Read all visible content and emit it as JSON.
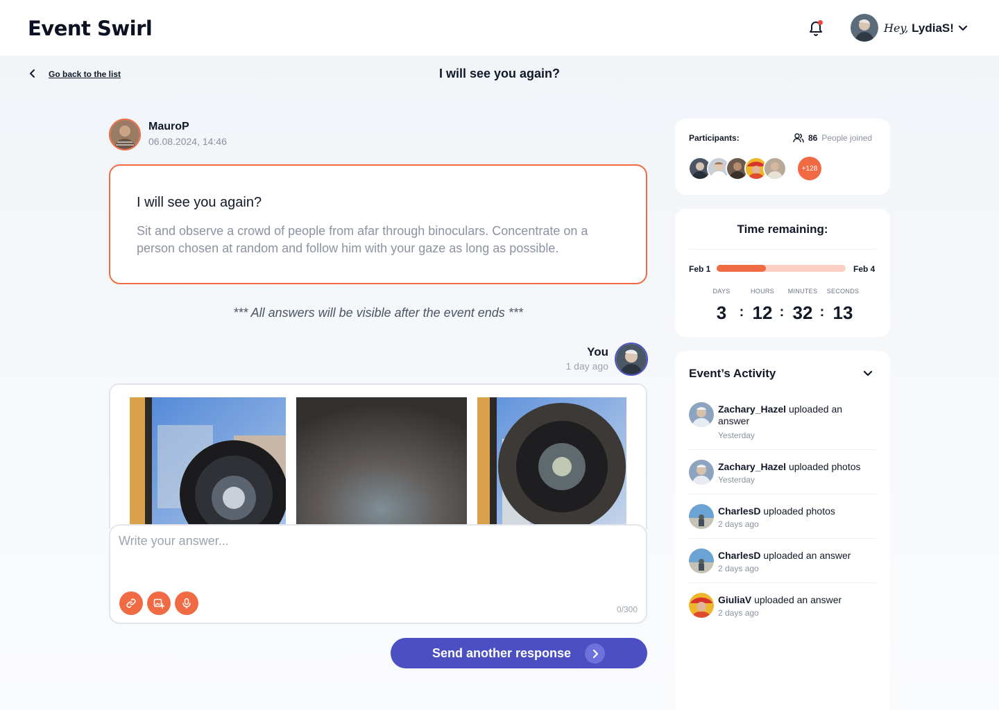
{
  "header": {
    "logo": "Event Swirl",
    "greeting_prefix": "Hey,",
    "username": "LydiaS!"
  },
  "nav": {
    "back_label": "Go back to the list",
    "page_title": "I will see you again?"
  },
  "post": {
    "author": "MauroP",
    "date": "06.08.2024, 14:46",
    "title": "I will see you again?",
    "body": "Sit and observe a crowd of people from afar through binoculars. Concentrate on a person chosen at random and follow him with your gaze as long as possible."
  },
  "notice": "*** All answers will be visible after the event ends ***",
  "response": {
    "author": "You",
    "time": "1 day ago"
  },
  "composer": {
    "placeholder": "Write your answer...",
    "counter": "0/300",
    "send_label": "Send another response"
  },
  "participants": {
    "label": "Participants:",
    "count": "86",
    "joined_label": "People joined",
    "more": "+128"
  },
  "timer": {
    "title": "Time remaining:",
    "start": "Feb 1",
    "end": "Feb 4",
    "progress": 0.38,
    "units": [
      {
        "label": "DAYS",
        "value": "3"
      },
      {
        "label": "HOURS",
        "value": "12"
      },
      {
        "label": "MINUTES",
        "value": "32"
      },
      {
        "label": "SECONDS",
        "value": "13"
      }
    ],
    "separator": ":"
  },
  "activity": {
    "title": "Event’s Activity",
    "items": [
      {
        "user": "Zachary_Hazel",
        "action": "uploaded an answer",
        "time": "Yesterday"
      },
      {
        "user": "Zachary_Hazel",
        "action": "uploaded photos",
        "time": "Yesterday"
      },
      {
        "user": "CharlesD",
        "action": "uploaded photos",
        "time": "2 days ago"
      },
      {
        "user": "CharlesD",
        "action": "uploaded an answer",
        "time": "2 days ago"
      },
      {
        "user": "GiuliaV",
        "action": "uploaded an answer",
        "time": "2 days ago"
      }
    ]
  },
  "colors": {
    "accent": "#f06a43",
    "primary": "#4b4fc2",
    "muted": "#8b92a0"
  }
}
